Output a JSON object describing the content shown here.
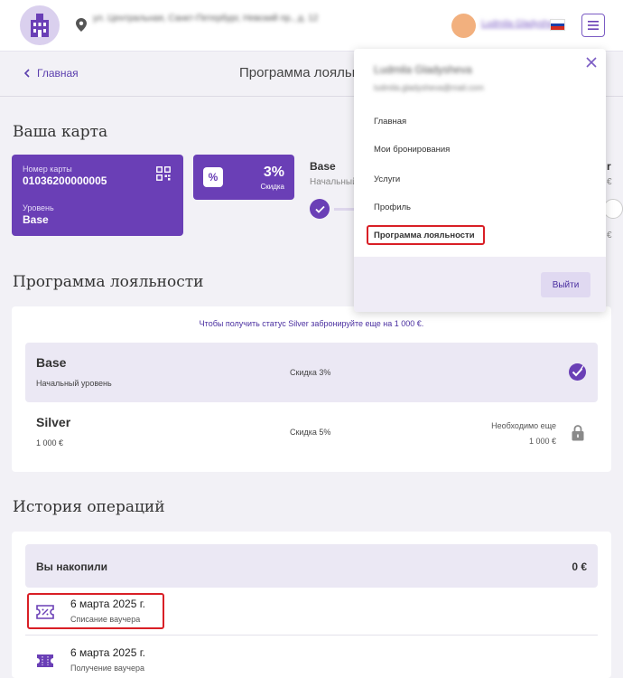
{
  "header": {
    "address": "ул. Центральная, Санкт-Петербург, Невский пр., д. 12",
    "user_name": "Ludmila Gladysheva",
    "flag_colors": [
      "#ffffff",
      "#1b3fa8",
      "#d52b1e"
    ],
    "logo_color": "#dad0ee"
  },
  "subbar": {
    "back_label": "Главная",
    "title": "Программа лояльности"
  },
  "card_section": {
    "title": "Ваша карта",
    "card_number_label": "Номер карты",
    "card_number": "01036200000005",
    "level_label": "Уровень",
    "level": "Base",
    "discount_value": "3%",
    "discount_label": "Скидка",
    "progress_current_name": "Base",
    "progress_current_sub": "Начальный",
    "edge_fragment_top": "r",
    "edge_fragment_euro": "€",
    "edge_fragment_euro2": "€"
  },
  "loyalty": {
    "title": "Программа лояльности",
    "notice": "Чтобы получить статус Silver забронируйте еще на 1 000 €.",
    "tiers": [
      {
        "name": "Base",
        "sub": "Начальный уровень",
        "discount": "Скидка 3%"
      },
      {
        "name": "Silver",
        "sub": "1 000 €",
        "discount": "Скидка 5%",
        "requirement_label": "Необходимо еще",
        "requirement_value": "1 000 €"
      }
    ]
  },
  "history": {
    "title": "История операций",
    "accumulated_label": "Вы накопили",
    "accumulated_value": "0 €",
    "operations": [
      {
        "date": "6 марта 2025 г.",
        "desc": "Списание ваучера"
      },
      {
        "date": "6 марта 2025 г.",
        "desc": "Получение ваучера"
      }
    ]
  },
  "dropdown": {
    "user_name": "Ludmila Gladysheva",
    "user_email": "ludmila.gladysheva@mail.com",
    "items": [
      "Главная",
      "Мои бронирования",
      "Услуги",
      "Профиль",
      "Программа лояльности"
    ],
    "logout_label": "Выйти"
  },
  "colors": {
    "accent": "#6a3fb6",
    "highlight": "#d91f26",
    "background": "#f2f1f6"
  }
}
